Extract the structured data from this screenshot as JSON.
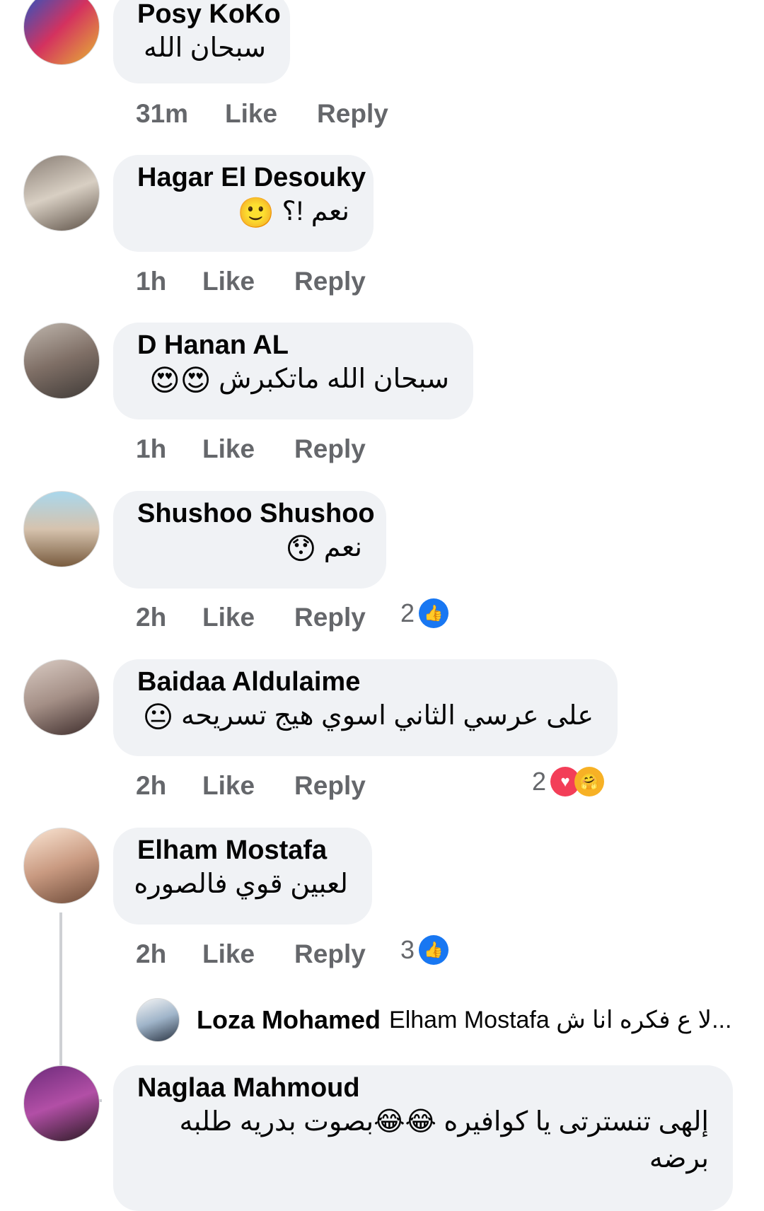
{
  "comments": [
    {
      "name": "Posy KoKo",
      "text": "سبحان الله",
      "emoji": "",
      "time": "31m",
      "like": "Like",
      "reply": "Reply",
      "reaction_count": ""
    },
    {
      "name": "Hagar El Desouky",
      "text": "نعم !؟",
      "emoji": "🙂",
      "time": "1h",
      "like": "Like",
      "reply": "Reply",
      "reaction_count": ""
    },
    {
      "name": "D Hanan AL",
      "text": "سبحان الله ماتكبرش",
      "emoji": "😍😍",
      "time": "1h",
      "like": "Like",
      "reply": "Reply",
      "reaction_count": ""
    },
    {
      "name": "Shushoo Shushoo",
      "text": "نعم",
      "emoji": "😯",
      "time": "2h",
      "like": "Like",
      "reply": "Reply",
      "reaction_count": "2"
    },
    {
      "name": "Baidaa Aldulaime",
      "text": "على عرسي الثاني اسوي هيج تسريحه",
      "emoji": "😐",
      "time": "2h",
      "like": "Like",
      "reply": "Reply",
      "reaction_count": "2"
    },
    {
      "name": "Elham Mostafa",
      "text": "لعبين قوي فالصوره",
      "emoji": "",
      "time": "2h",
      "like": "Like",
      "reply": "Reply",
      "reaction_count": "3"
    },
    {
      "name": "Naglaa Mahmoud",
      "text": "إلهى تنسترتى يا كوافيره 😂😂بصوت بدريه طلبه برضه",
      "emoji": "",
      "time": "",
      "like": "",
      "reply": "",
      "reaction_count": ""
    }
  ],
  "reply_preview": {
    "name": "Loza Mohamed",
    "text": "Elham Mostafa لا ع فكره انا ش..."
  },
  "colors": {
    "bubble": "#f0f2f5",
    "meta": "#65676b",
    "like_blue": "#1877f2",
    "love_red": "#f33e58"
  },
  "icons": {
    "like": "thumbs-up-icon",
    "love": "heart-icon",
    "care": "care-icon"
  }
}
